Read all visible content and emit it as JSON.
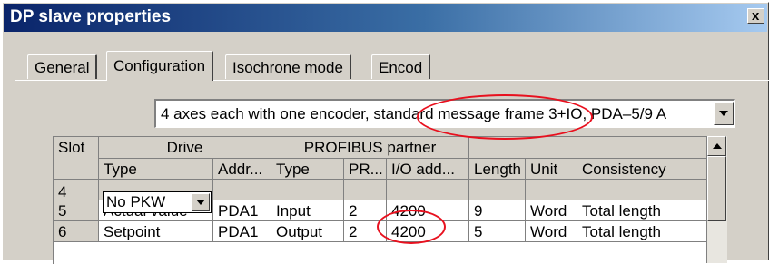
{
  "window": {
    "title": "DP slave properties",
    "close_label": "x"
  },
  "tabs": [
    {
      "label": "General",
      "active": false
    },
    {
      "label": "Configuration",
      "active": true
    },
    {
      "label": "Isochrone mode",
      "active": false
    },
    {
      "label": "Encod",
      "active": false
    }
  ],
  "telegram_select": {
    "value": "4 axes each with one encoder, standard message frame 3+IO, PDA–5/9 A"
  },
  "grid": {
    "group_headers": {
      "slot": "Slot",
      "drive": "Drive",
      "profibus_partner": "PROFIBUS partner"
    },
    "column_headers": [
      "Type",
      "Addr...",
      "Type",
      "PR...",
      "I/O add...",
      "Length",
      "Unit",
      "Consistency"
    ],
    "rows": [
      {
        "slot": "4",
        "drive_type": "No PKW",
        "addr": "",
        "partner_type": "",
        "pr": "",
        "io_addr": "",
        "length": "",
        "unit": "",
        "consistency": ""
      },
      {
        "slot": "5",
        "drive_type": "Actual value",
        "addr": "PDA1",
        "partner_type": "Input",
        "pr": "2",
        "io_addr": "4200",
        "length": "9",
        "unit": "Word",
        "consistency": "Total length"
      },
      {
        "slot": "6",
        "drive_type": "Setpoint",
        "addr": "PDA1",
        "partner_type": "Output",
        "pr": "2",
        "io_addr": "4200",
        "length": "5",
        "unit": "Word",
        "consistency": "Total length"
      }
    ]
  },
  "colors": {
    "title_bar_start": "#0a246a",
    "title_bar_end": "#a6caf0",
    "dialog_face": "#d4d0c8",
    "annotation": "#e8101e"
  },
  "icons": [
    "close-icon",
    "dropdown-arrow-icon",
    "scroll-up-arrow-icon"
  ]
}
